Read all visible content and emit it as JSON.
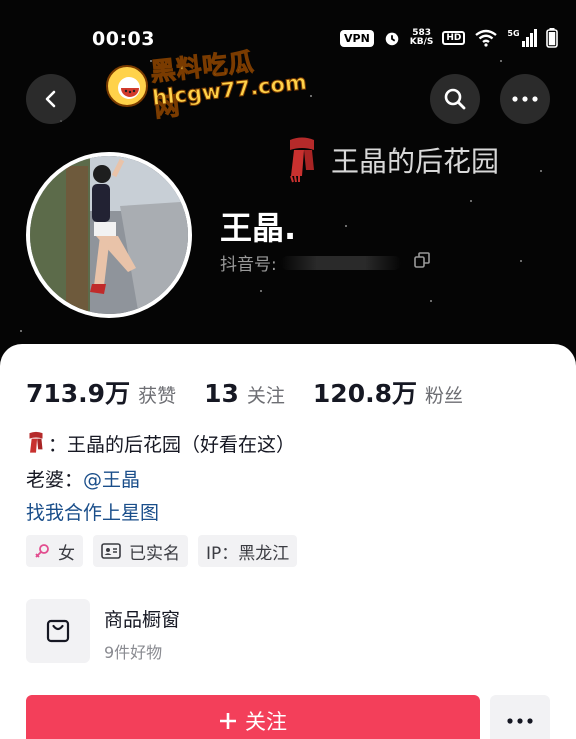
{
  "status_bar": {
    "time": "00:03",
    "vpn": "VPN",
    "net_speed_value": "583",
    "net_speed_unit": "KB/S",
    "hd": "HD",
    "network": "5G"
  },
  "watermark": {
    "title": "黑料吃瓜网",
    "url": "hlcgw77.com"
  },
  "header": {
    "background_title": "王晶的后花园",
    "background_icon": "scarf-icon"
  },
  "profile": {
    "name": "王晶.",
    "id_label": "抖音号:"
  },
  "stats": [
    {
      "value": "713.9万",
      "label": "获赞"
    },
    {
      "value": "13",
      "label": "关注"
    },
    {
      "value": "120.8万",
      "label": "粉丝"
    }
  ],
  "bio": {
    "line1": "：王晶的后花园（好看在这）",
    "line2_prefix": "老婆：",
    "line2_mention": "@王晶",
    "line3_link": "找我合作上星图"
  },
  "tags": {
    "gender": "女",
    "verified": "已实名",
    "ip": "IP：黑龙江"
  },
  "shop": {
    "title": "商品橱窗",
    "subtitle": "9件好物"
  },
  "actions": {
    "follow": "关注"
  },
  "colors": {
    "accent": "#f33f5a",
    "link": "#1a4e8a",
    "header_bg": "#050505"
  }
}
